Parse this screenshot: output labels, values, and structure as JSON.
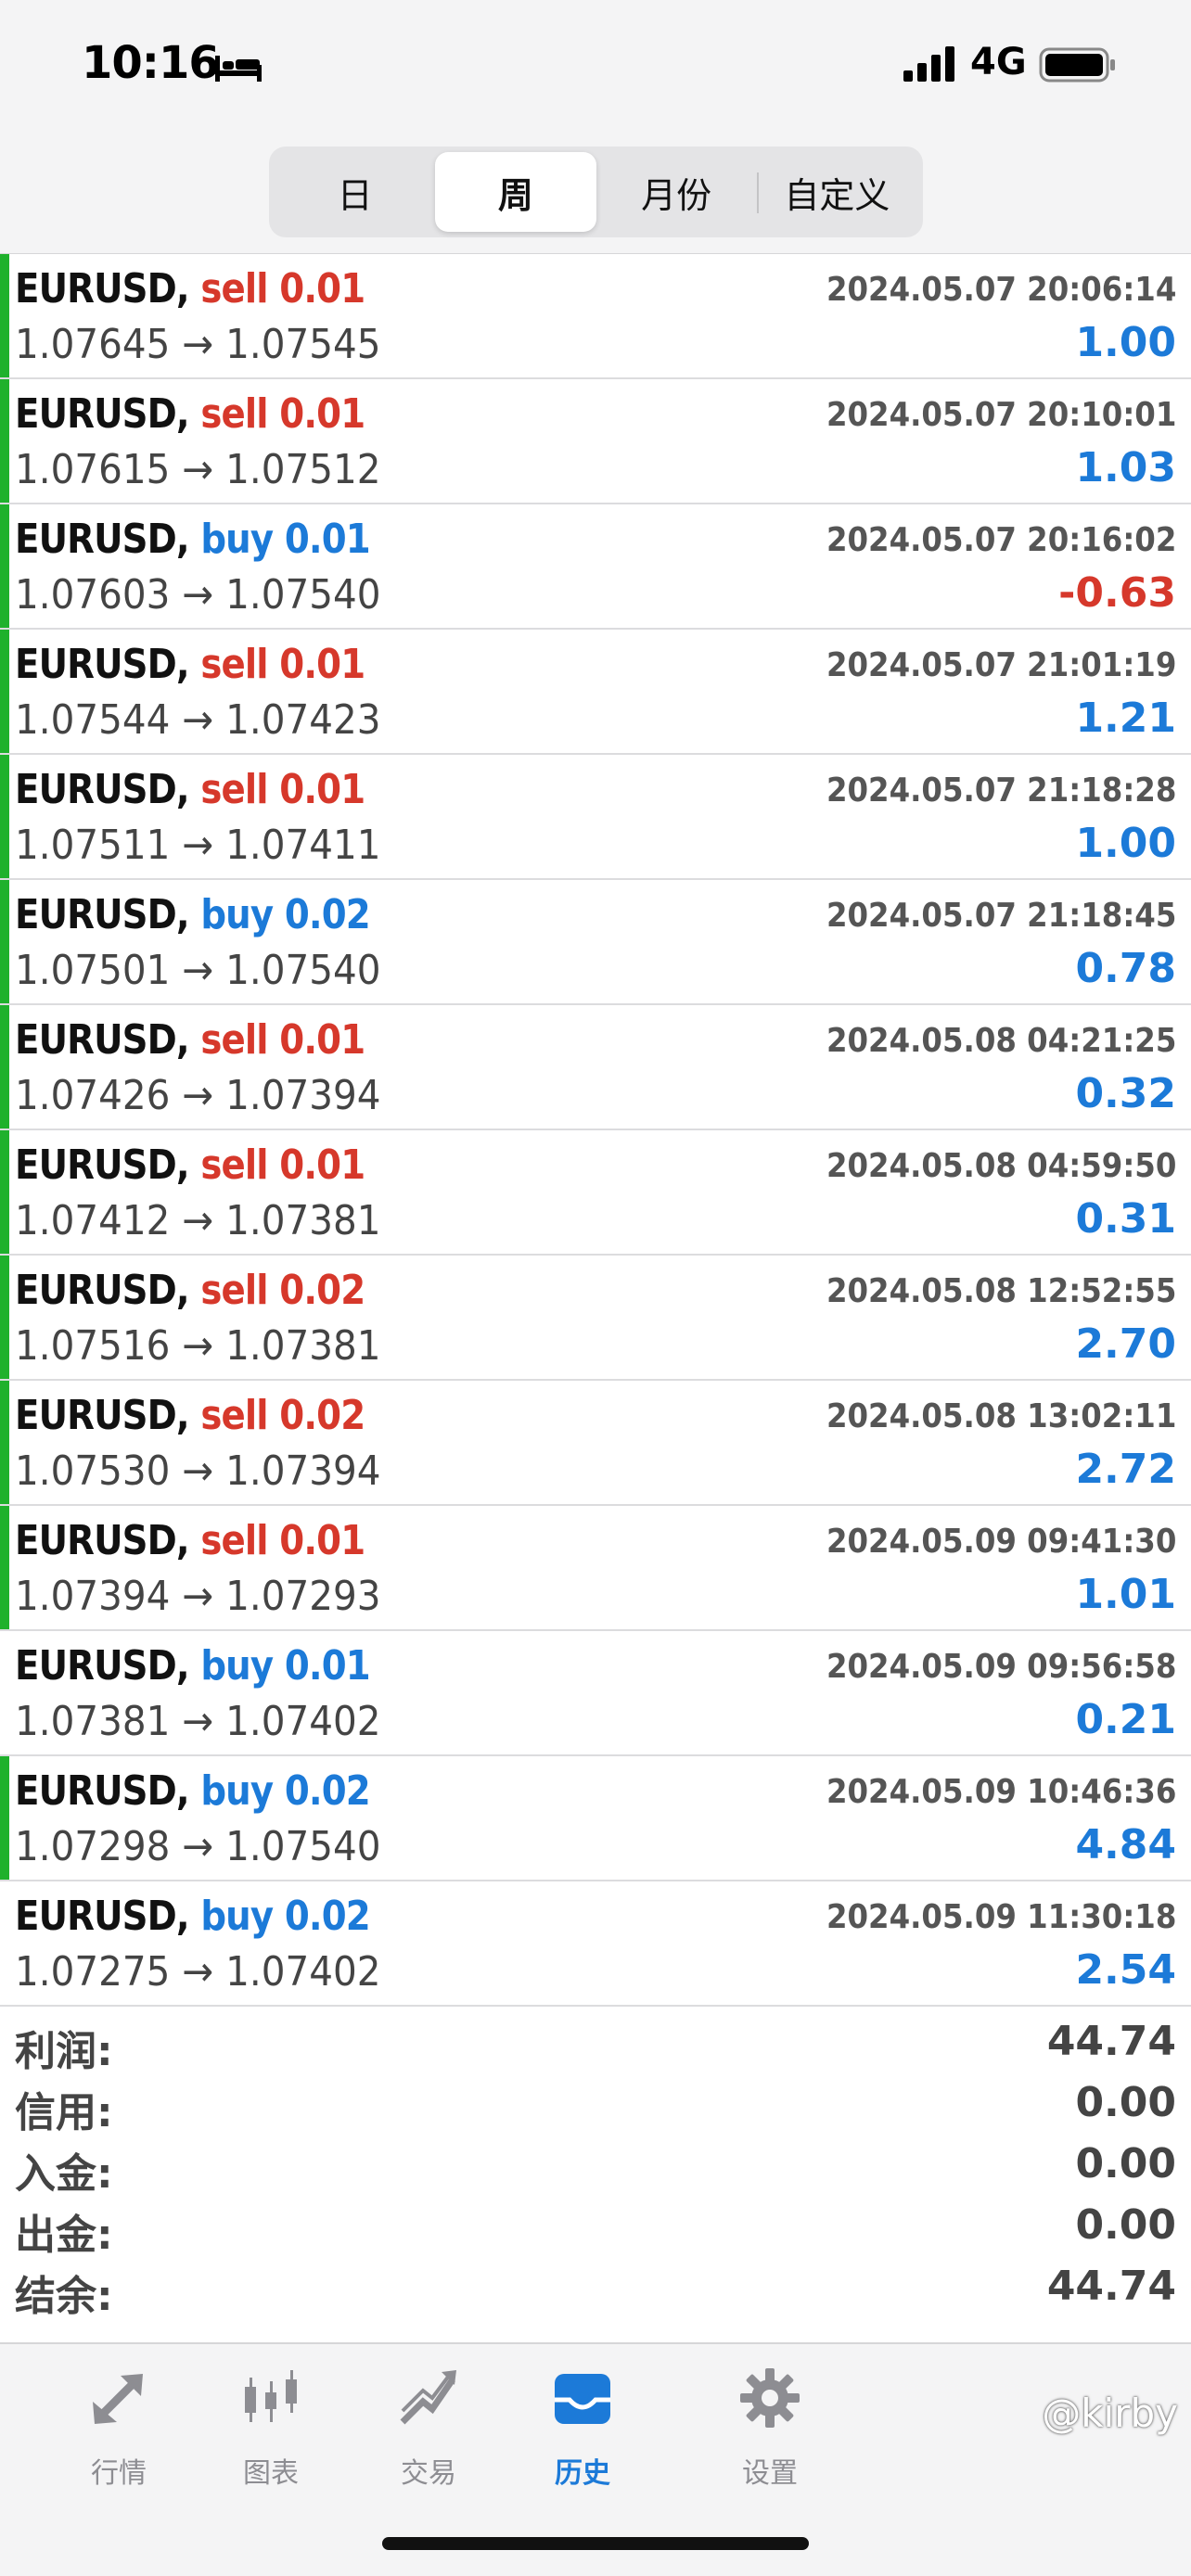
{
  "status_bar": {
    "time": "10:16",
    "network": "4G"
  },
  "tabs_period": [
    {
      "label": "日",
      "active": false
    },
    {
      "label": "周",
      "active": true
    },
    {
      "label": "月份",
      "active": false
    },
    {
      "label": "自定义",
      "active": false
    }
  ],
  "trades": [
    {
      "symbol": "EURUSD,",
      "side": "sell",
      "volume": "0.01",
      "time": "2024.05.07 20:06:14",
      "open": "1.07645",
      "close": "1.07545",
      "profit": "1.00",
      "marker": true
    },
    {
      "symbol": "EURUSD,",
      "side": "sell",
      "volume": "0.01",
      "time": "2024.05.07 20:10:01",
      "open": "1.07615",
      "close": "1.07512",
      "profit": "1.03",
      "marker": true
    },
    {
      "symbol": "EURUSD,",
      "side": "buy",
      "volume": "0.01",
      "time": "2024.05.07 20:16:02",
      "open": "1.07603",
      "close": "1.07540",
      "profit": "-0.63",
      "marker": true
    },
    {
      "symbol": "EURUSD,",
      "side": "sell",
      "volume": "0.01",
      "time": "2024.05.07 21:01:19",
      "open": "1.07544",
      "close": "1.07423",
      "profit": "1.21",
      "marker": true
    },
    {
      "symbol": "EURUSD,",
      "side": "sell",
      "volume": "0.01",
      "time": "2024.05.07 21:18:28",
      "open": "1.07511",
      "close": "1.07411",
      "profit": "1.00",
      "marker": true
    },
    {
      "symbol": "EURUSD,",
      "side": "buy",
      "volume": "0.02",
      "time": "2024.05.07 21:18:45",
      "open": "1.07501",
      "close": "1.07540",
      "profit": "0.78",
      "marker": true
    },
    {
      "symbol": "EURUSD,",
      "side": "sell",
      "volume": "0.01",
      "time": "2024.05.08 04:21:25",
      "open": "1.07426",
      "close": "1.07394",
      "profit": "0.32",
      "marker": true
    },
    {
      "symbol": "EURUSD,",
      "side": "sell",
      "volume": "0.01",
      "time": "2024.05.08 04:59:50",
      "open": "1.07412",
      "close": "1.07381",
      "profit": "0.31",
      "marker": true
    },
    {
      "symbol": "EURUSD,",
      "side": "sell",
      "volume": "0.02",
      "time": "2024.05.08 12:52:55",
      "open": "1.07516",
      "close": "1.07381",
      "profit": "2.70",
      "marker": true
    },
    {
      "symbol": "EURUSD,",
      "side": "sell",
      "volume": "0.02",
      "time": "2024.05.08 13:02:11",
      "open": "1.07530",
      "close": "1.07394",
      "profit": "2.72",
      "marker": true
    },
    {
      "symbol": "EURUSD,",
      "side": "sell",
      "volume": "0.01",
      "time": "2024.05.09 09:41:30",
      "open": "1.07394",
      "close": "1.07293",
      "profit": "1.01",
      "marker": true
    },
    {
      "symbol": "EURUSD,",
      "side": "buy",
      "volume": "0.01",
      "time": "2024.05.09 09:56:58",
      "open": "1.07381",
      "close": "1.07402",
      "profit": "0.21",
      "marker": false
    },
    {
      "symbol": "EURUSD,",
      "side": "buy",
      "volume": "0.02",
      "time": "2024.05.09 10:46:36",
      "open": "1.07298",
      "close": "1.07540",
      "profit": "4.84",
      "marker": true
    },
    {
      "symbol": "EURUSD,",
      "side": "buy",
      "volume": "0.02",
      "time": "2024.05.09 11:30:18",
      "open": "1.07275",
      "close": "1.07402",
      "profit": "2.54",
      "marker": false
    }
  ],
  "arrow": "→",
  "summary": [
    {
      "label": "利润:",
      "value": "44.74"
    },
    {
      "label": "信用:",
      "value": "0.00"
    },
    {
      "label": "入金:",
      "value": "0.00"
    },
    {
      "label": "出金:",
      "value": "0.00"
    },
    {
      "label": "结余:",
      "value": "44.74"
    }
  ],
  "tab_bar": [
    {
      "label": "行情",
      "icon": "quotes-arrows-icon",
      "active": false
    },
    {
      "label": "图表",
      "icon": "candlestick-chart-icon",
      "active": false
    },
    {
      "label": "交易",
      "icon": "trade-chart-icon",
      "active": false
    },
    {
      "label": "历史",
      "icon": "history-tray-icon",
      "active": true
    },
    {
      "label": "设置",
      "icon": "gear-icon",
      "active": false
    }
  ],
  "watermark": "@kirby",
  "colors": {
    "sell": "#d6382b",
    "buy": "#1c7ad8",
    "marker": "#1fb12c",
    "tab_active": "#1c7ad8",
    "tab_inactive": "#8d8d92"
  }
}
